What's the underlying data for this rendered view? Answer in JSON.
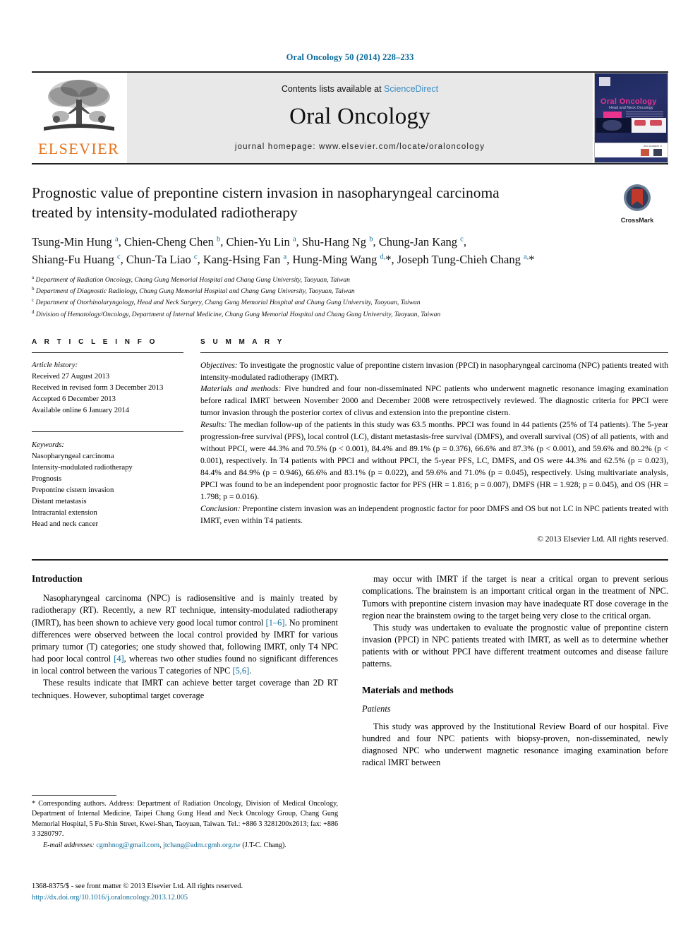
{
  "running_head": "Oral Oncology 50 (2014) 228–233",
  "masthead": {
    "publisher_name": "ELSEVIER",
    "contents_prefix": "Contents lists available at ",
    "sciencedirect": "ScienceDirect",
    "journal_title": "Oral Oncology",
    "homepage": "journal homepage: www.elsevier.com/locate/oraloncology",
    "cover": {
      "title": "Oral Oncology",
      "subtitle": "Head and Neck Oncology",
      "tiny_note": "Also available in"
    }
  },
  "article": {
    "title": "Prognostic value of prepontine cistern invasion in nasopharyngeal carcinoma treated by intensity-modulated radiotherapy",
    "crossmark_label": "CrossMark",
    "authors_line_1": "Tsung-Min Hung <sup>a</sup>, Chien-Cheng Chen <sup>b</sup>, Chien-Yu Lin <sup>a</sup>, Shu-Hang Ng <sup>b</sup>, Chung-Jan Kang <sup>c</sup>,",
    "authors_line_2": "Shiang-Fu Huang <sup>c</sup>, Chun-Ta Liao <sup>c</sup>, Kang-Hsing Fan <sup>a</sup>, Hung-Ming Wang <sup>d,</sup>*, Joseph Tung-Chieh Chang <sup>a,</sup>*",
    "affiliations": [
      "<sup>a</sup> Department of Radiation Oncology, Chang Gung Memorial Hospital and Chang Gung University, Taoyuan, Taiwan",
      "<sup>b</sup> Department of Diagnostic Radiology, Chang Gung Memorial Hospital and Chang Gung University, Taoyuan, Taiwan",
      "<sup>c</sup> Department of Otorhinolaryngology, Head and Neck Surgery, Chang Gung Memorial Hospital and Chang Gung University, Taoyuan, Taiwan",
      "<sup>d</sup> Division of Hematology/Oncology, Department of Internal Medicine, Chang Gung Memorial Hospital and Chang Gung University, Taoyuan, Taiwan"
    ]
  },
  "article_info": {
    "heading": "A R T I C L E   I N F O",
    "history_label": "Article history:",
    "history": [
      "Received 27 August 2013",
      "Received in revised form 3 December 2013",
      "Accepted 6 December 2013",
      "Available online 6 January 2014"
    ],
    "keywords_label": "Keywords:",
    "keywords": [
      "Nasopharyngeal carcinoma",
      "Intensity-modulated radiotherapy",
      "Prognosis",
      "Prepontine cistern invasion",
      "Distant metastasis",
      "Intracranial extension",
      "Head and neck cancer"
    ]
  },
  "summary": {
    "heading": "S U M M A R Y",
    "objectives_label": "Objectives:",
    "objectives_text": " To investigate the prognostic value of prepontine cistern invasion (PPCI) in nasopharyngeal carcinoma (NPC) patients treated with intensity-modulated radiotherapy (IMRT).",
    "methods_label": "Materials and methods:",
    "methods_text": " Five hundred and four non-disseminated NPC patients who underwent magnetic resonance imaging examination before radical IMRT between November 2000 and December 2008 were retrospectively reviewed. The diagnostic criteria for PPCI were tumor invasion through the posterior cortex of clivus and extension into the prepontine cistern.",
    "results_label": "Results:",
    "results_text": " The median follow-up of the patients in this study was 63.5 months. PPCI was found in 44 patients (25% of T4 patients). The 5-year progression-free survival (PFS), local control (LC), distant metastasis-free survival (DMFS), and overall survival (OS) of all patients, with and without PPCI, were 44.3% and 70.5% (p < 0.001), 84.4% and 89.1% (p = 0.376), 66.6% and 87.3% (p < 0.001), and 59.6% and 80.2% (p < 0.001), respectively. In T4 patients with PPCI and without PPCI, the 5-year PFS, LC, DMFS, and OS were 44.3% and 62.5% (p = 0.023), 84.4% and 84.9% (p = 0.946), 66.6% and 83.1% (p = 0.022), and 59.6% and 71.0% (p = 0.045), respectively. Using multivariate analysis, PPCI was found to be an independent poor prognostic factor for PFS (HR = 1.816; p = 0.007), DMFS (HR = 1.928; p = 0.045), and OS (HR = 1.798; p = 0.016).",
    "conclusion_label": "Conclusion:",
    "conclusion_text": " Prepontine cistern invasion was an independent prognostic factor for poor DMFS and OS but not LC in NPC patients treated with IMRT, even within T4 patients.",
    "copyright": "© 2013 Elsevier Ltd. All rights reserved."
  },
  "body": {
    "introduction_heading": "Introduction",
    "intro_p1_a": "Nasopharyngeal carcinoma (NPC) is radiosensitive and is mainly treated by radiotherapy (RT). Recently, a new RT technique, intensity-modulated radiotherapy (IMRT), has been shown to achieve very good local tumor control ",
    "intro_ref1": "[1–6]",
    "intro_p1_b": ". No prominent differences were observed between the local control provided by IMRT for various primary tumor (T) categories; one study showed that, following IMRT, only T4 NPC had poor local control ",
    "intro_ref2": "[4]",
    "intro_p1_c": ", whereas two other studies found no significant differences in local control between the various T categories of NPC ",
    "intro_ref3": "[5,6]",
    "intro_p1_d": ".",
    "intro_p2": "These results indicate that IMRT can achieve better target coverage than 2D RT techniques. However, suboptimal target coverage",
    "right_p1": "may occur with IMRT if the target is near a critical organ to prevent serious complications. The brainstem is an important critical organ in the treatment of NPC. Tumors with prepontine cistern invasion may have inadequate RT dose coverage in the region near the brainstem owing to the target being very close to the critical organ.",
    "right_p2": "This study was undertaken to evaluate the prognostic value of prepontine cistern invasion (PPCI) in NPC patients treated with IMRT, as well as to determine whether patients with or without PPCI have different treatment outcomes and disease failure patterns.",
    "materials_heading": "Materials and methods",
    "patients_heading": "Patients",
    "patients_p1": "This study was approved by the Institutional Review Board of our hospital. Five hundred and four NPC patients with biopsy-proven, non-disseminated, newly diagnosed NPC who underwent magnetic resonance imaging examination before radical IMRT between"
  },
  "footnotes": {
    "corresponding": "* Corresponding authors. Address: Department of Radiation Oncology, Division of Medical Oncology, Department of Internal Medicine, Taipei Chang Gung Head and Neck Oncology Group, Chang Gung Memorial Hospital, 5 Fu-Shin Street, Kwei-Shan, Taoyuan, Taiwan. Tel.: +886 3 3281200x2613; fax: +886 3 3280797.",
    "email_label": "E-mail addresses:",
    "email_1": "cgmhnog@gmail.com",
    "email_2": "jtchang@adm.cgmh.org.tw",
    "email_suffix": " (J.T-C. Chang).",
    "issn_line": "1368-8375/$ - see front matter © 2013 Elsevier Ltd. All rights reserved.",
    "doi_line": "http://dx.doi.org/10.1016/j.oraloncology.2013.12.005"
  },
  "colors": {
    "link_blue": "#0b6a99",
    "sciencedirect_blue": "#3a8dc4",
    "elsevier_orange": "#e8731b",
    "cover_pink": "#e8338f"
  }
}
